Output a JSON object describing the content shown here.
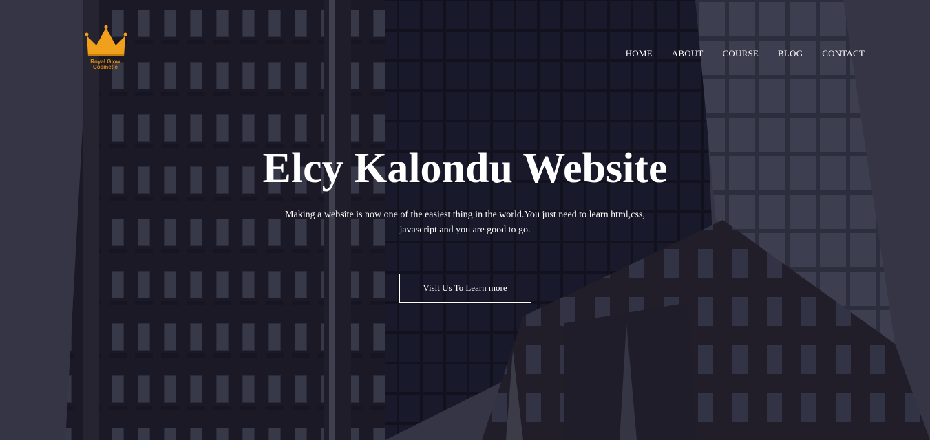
{
  "logo": {
    "line1": "Royal Glow",
    "line2": "Cosmetic",
    "icon": "crown-icon",
    "color": "#f0a01a"
  },
  "nav": {
    "items": [
      {
        "label": "HOME"
      },
      {
        "label": "ABOUT"
      },
      {
        "label": "COURSE"
      },
      {
        "label": "BLOG"
      },
      {
        "label": "CONTACT"
      }
    ]
  },
  "hero": {
    "title": "Elcy Kalondu Website",
    "subtitle": "Making a website is now one of the easiest thing in the world.You just need to learn html,css, javascript and you are good to go.",
    "cta_label": "Visit Us To Learn more"
  },
  "colors": {
    "background": "#4a4b5a",
    "text": "#ffffff",
    "accent": "#f0a01a"
  }
}
